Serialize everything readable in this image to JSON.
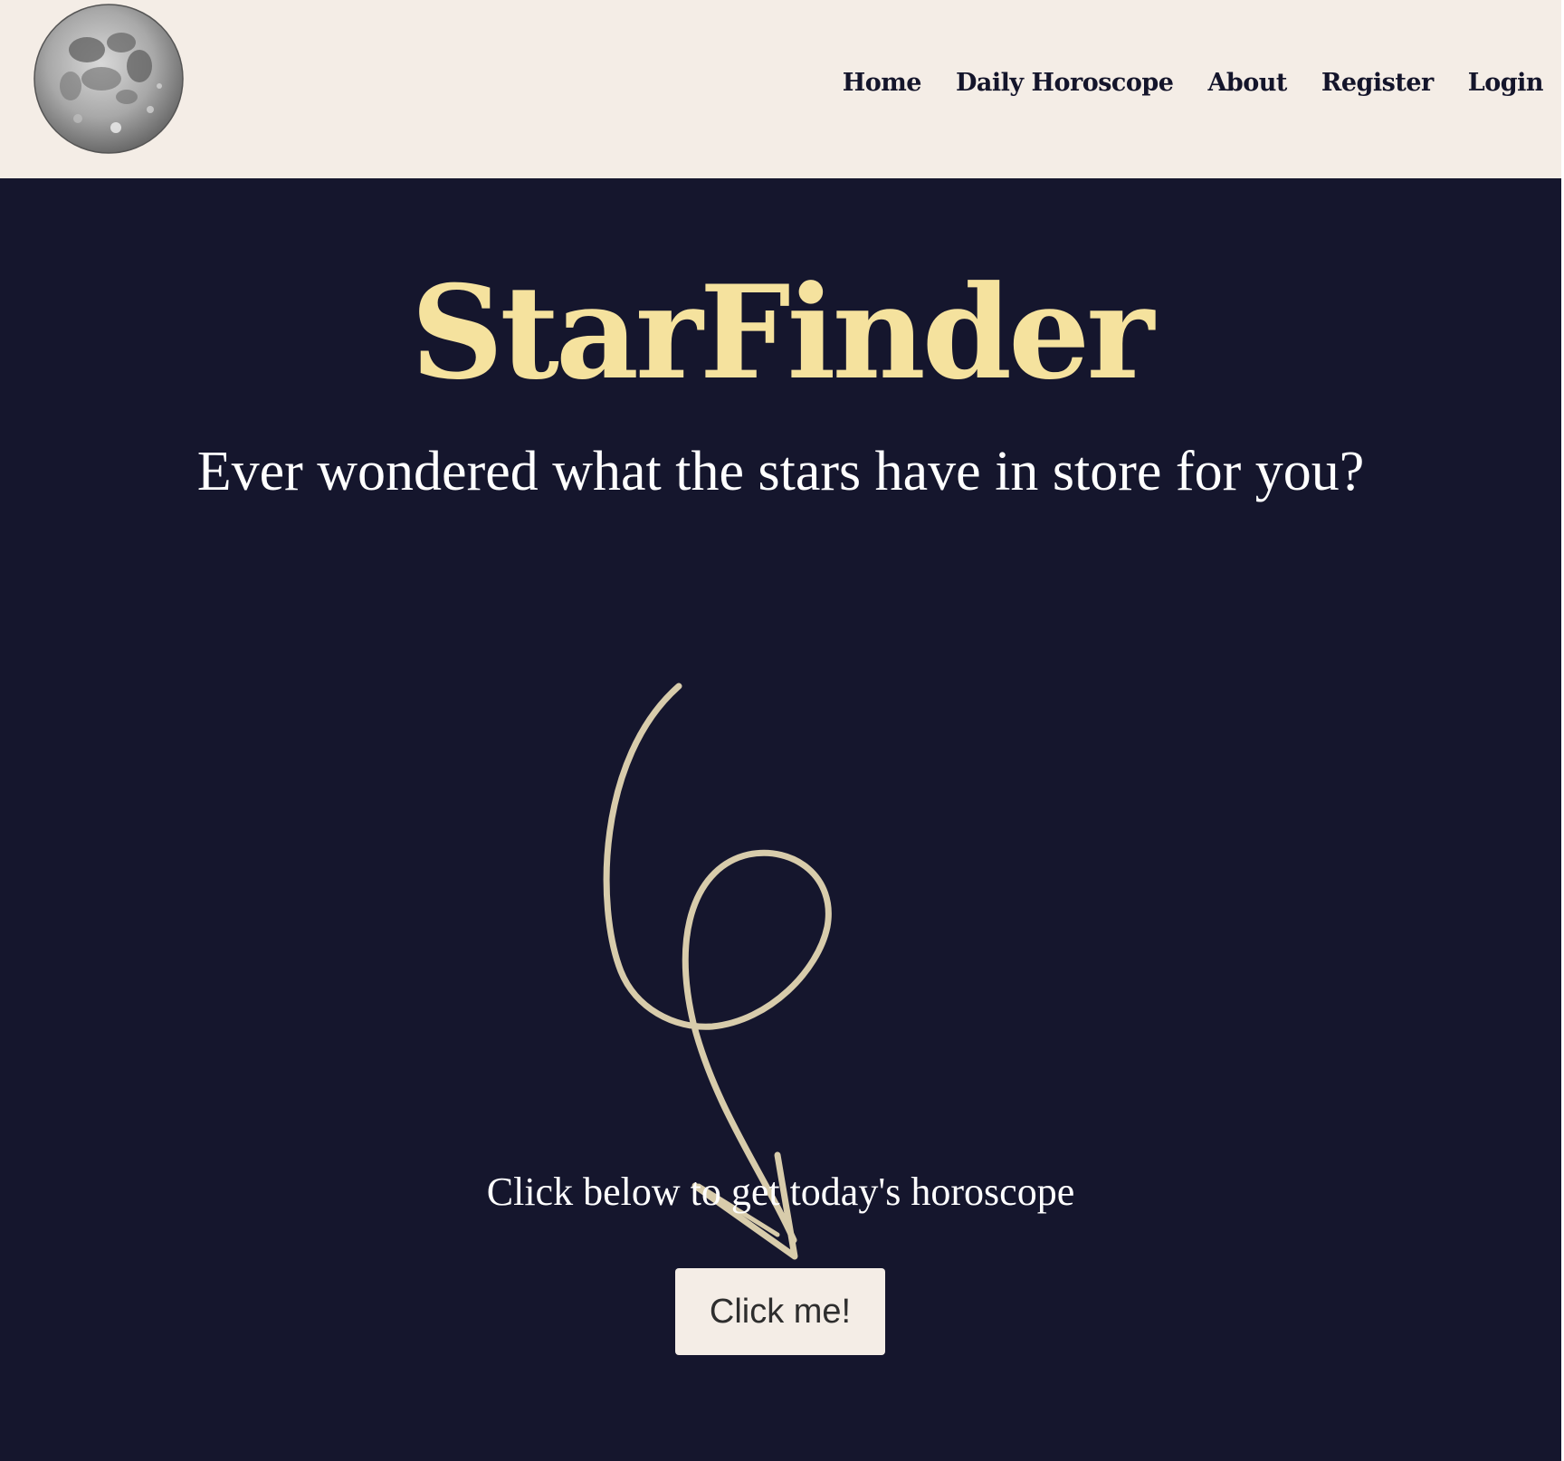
{
  "navbar": {
    "logo_icon": "moon-icon",
    "links": [
      {
        "label": "Home"
      },
      {
        "label": "Daily Horoscope"
      },
      {
        "label": "About"
      },
      {
        "label": "Register"
      },
      {
        "label": "Login"
      }
    ]
  },
  "hero": {
    "title": "StarFinder",
    "subtitle": "Ever wondered what the stars have in store for you?",
    "arrow_icon": "curly-arrow-down-icon",
    "prompt": "Click below to get today's horoscope",
    "button_label": "Click me!"
  },
  "colors": {
    "nav_background": "#f4ede6",
    "hero_background": "#15162d",
    "title_color": "#f5e29e",
    "arrow_color": "#d8ccab",
    "button_background": "#f4ede6"
  }
}
